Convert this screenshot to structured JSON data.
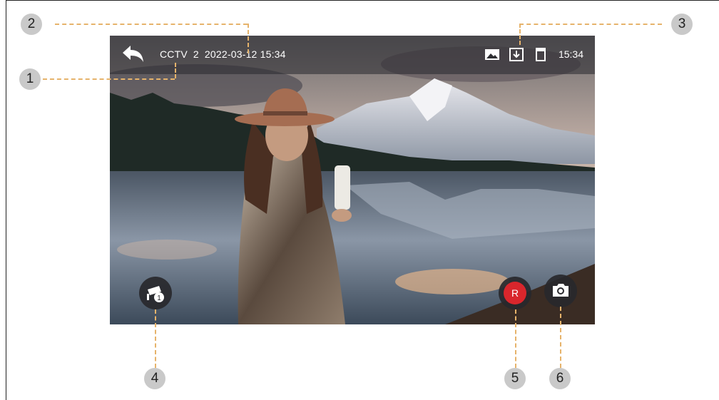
{
  "header": {
    "camera": "CCTV",
    "camera_number": "2",
    "datetime": "2022-03-12 15:34",
    "clock": "15:34"
  },
  "icons": {
    "back": "back-arrow-icon",
    "gallery": "image-icon",
    "download": "download-icon",
    "storage": "sd-card-icon",
    "monitor": "cctv-camera-icon",
    "record": "record-button",
    "snapshot": "camera-icon"
  },
  "record_label": "R",
  "monitor_badge": "1",
  "callouts": [
    "1",
    "2",
    "3",
    "4",
    "5",
    "6"
  ],
  "colors": {
    "record": "#d9262c",
    "callout_line": "#e6b36b",
    "callout_badge": "#c9c9c9"
  }
}
